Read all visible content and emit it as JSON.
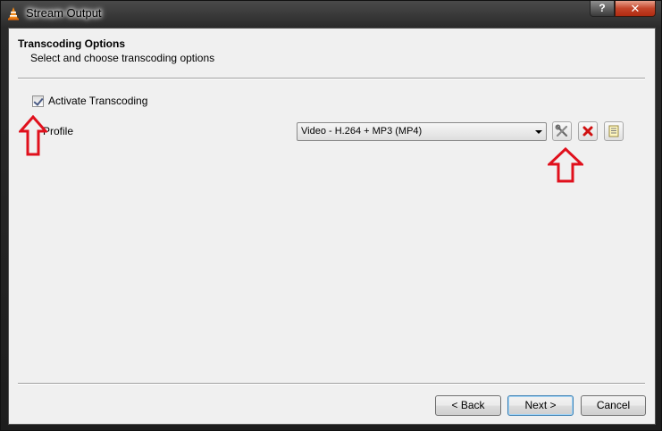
{
  "window": {
    "title": "Stream Output",
    "help_glyph": "?",
    "close_glyph": "✕"
  },
  "header": {
    "title": "Transcoding Options",
    "subtitle": "Select and choose transcoding options"
  },
  "transcoding": {
    "checkbox_label": "Activate Transcoding",
    "checked": true
  },
  "profile": {
    "label": "Profile",
    "selected": "Video - H.264 + MP3 (MP4)"
  },
  "buttons": {
    "back": "Back",
    "next": "Next >",
    "cancel": "Cancel"
  },
  "icons": {
    "edit": "wrench-screwdriver-icon",
    "delete": "red-x-icon",
    "new": "notepad-icon"
  },
  "colors": {
    "annotation_arrow": "#e0101c"
  }
}
